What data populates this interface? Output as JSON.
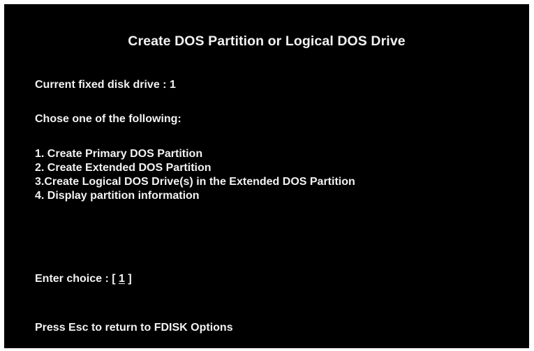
{
  "screen": {
    "title": "Create DOS Partition or Logical DOS Drive",
    "current_drive_line": "Current fixed disk drive : 1",
    "prompt_line": "Chose one of the following:",
    "menu_items": [
      {
        "label": "1. Create Primary DOS Partition"
      },
      {
        "label": "2. Create Extended DOS Partition"
      },
      {
        "label": "3.Create Logical DOS Drive(s) in the Extended DOS Partition"
      },
      {
        "label": "4. Display partition information"
      }
    ],
    "entry": {
      "label": "Enter choice : [ ",
      "value": "1",
      "suffix": " ]"
    },
    "footer_line": "Press Esc to return to FDISK Options"
  },
  "colors": {
    "background": "#000000",
    "text": "#f2f2f2"
  }
}
